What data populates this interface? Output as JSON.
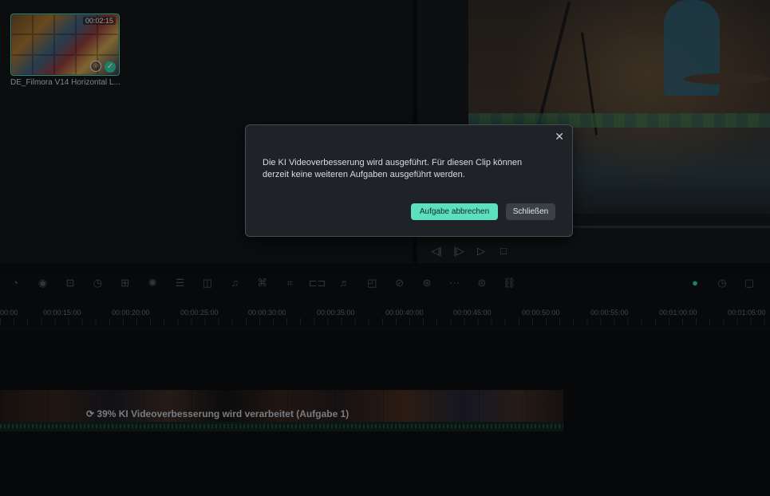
{
  "media": {
    "thumb_duration": "00:02:15",
    "thumb_label": "DE_Filmora V14 Horizontal L..."
  },
  "transport_icons": [
    "prev-frame-icon",
    "play-forward-icon",
    "play-icon",
    "stop-icon"
  ],
  "toolbar": {
    "icons": [
      "speed-icon",
      "color-icon",
      "ai-portrait-icon",
      "timer-icon",
      "crop-icon",
      "mask-icon",
      "adjust-icon",
      "audio-icon",
      "voice-icon",
      "tts-icon",
      "subtitle-icon",
      "stretch-icon",
      "audio-stretch-icon",
      "frame-icon",
      "smart-cut-icon",
      "ai-edit-icon",
      "keyframe-icon",
      "translate-icon",
      "unlink-icon"
    ],
    "right_icons": [
      "ai-bot-icon",
      "render-icon",
      "marker-icon"
    ]
  },
  "timeline": {
    "ticks": [
      "00:00",
      "00:00:15:00",
      "00:00:20:00",
      "00:00:25:00",
      "00:00:30:00",
      "00:00:35:00",
      "00:00:40:00",
      "00:00:45:00",
      "00:00:50:00",
      "00:00:55:00",
      "00:01:00:00",
      "00:01:05:00"
    ],
    "clip_status": "39% KI Videoverbesserung wird verarbeitet (Aufgabe 1)"
  },
  "dialog": {
    "message": "Die KI Videoverbesserung wird ausgeführt. Für diesen Clip können derzeit keine weiteren Aufgaben ausgeführt werden.",
    "cancel_task_label": "Aufgabe abbrechen",
    "close_label": "Schließen"
  },
  "colors": {
    "accent": "#5ce0c0",
    "success": "#2fc59c"
  }
}
